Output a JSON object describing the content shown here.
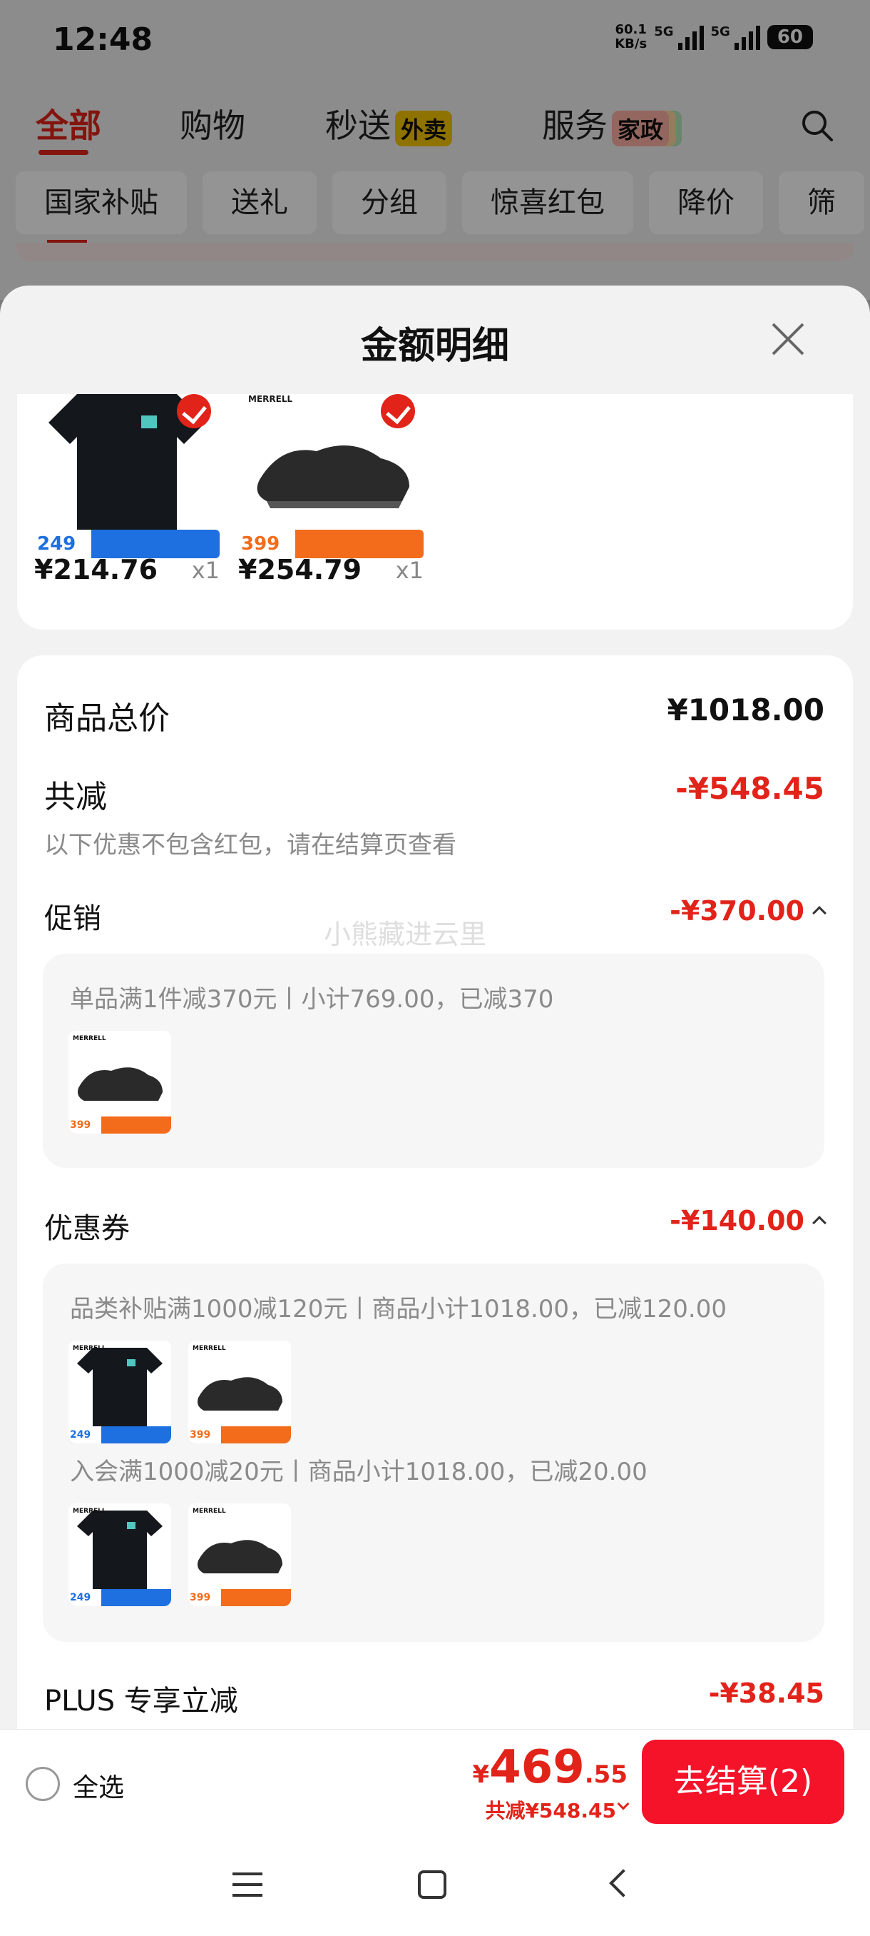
{
  "status_bar": {
    "time": "12:48",
    "net_speed_value": "60.1",
    "net_speed_unit": "KB/s",
    "sim1_label": "5G",
    "sim2_label": "5G",
    "battery": "60"
  },
  "top_nav": {
    "tabs": [
      {
        "label": "全部"
      },
      {
        "label": "购物"
      },
      {
        "label": "秒送",
        "badge": "外卖"
      },
      {
        "label": "服务",
        "badge": "家政"
      }
    ],
    "search_icon": "search-icon"
  },
  "filter_chips": [
    "国家补贴",
    "送礼",
    "分组",
    "惊喜红包",
    "降价",
    "筛"
  ],
  "sheet": {
    "title": "金额明细",
    "close_icon": "close-icon",
    "products": [
      {
        "price": "¥214.76",
        "qty": "x1",
        "tag_price": "249",
        "tag_color": "#1e6fe0"
      },
      {
        "price": "¥254.79",
        "qty": "x1",
        "tag_price": "399",
        "tag_color": "#f26c1c",
        "brand": "MERRELL"
      }
    ],
    "summary": {
      "total_label": "商品总价",
      "total_value": "¥1018.00",
      "discount_label": "共减",
      "discount_value": "-¥548.45",
      "discount_note": "以下优惠不包含红包，请在结算页查看",
      "promo_label": "促销",
      "promo_value": "-¥370.00",
      "promo_detail": "单品满1件减370元丨小计769.00，已减370",
      "coupon_label": "优惠券",
      "coupon_value": "-¥140.00",
      "coupon_detail_1": "品类补贴满1000减120元丨商品小计1018.00，已减120.00",
      "coupon_detail_2": "入会满1000减20元丨商品小计1018.00，已减20.00",
      "plus_label": "PLUS 专享立减",
      "plus_value": "-¥38.45"
    },
    "watermark": "小熊藏进云里"
  },
  "bottom_bar": {
    "select_all": "全选",
    "yen": "¥",
    "price_int": "469",
    "price_dec": ".55",
    "total_save": "共减¥548.45",
    "checkout": "去结算(2)"
  },
  "colors": {
    "accent_red": "#e2231a",
    "checkout_red": "#f5132a",
    "tshirt_tag_blue": "#1e6fe0",
    "shoe_tag_orange": "#f26c1c"
  }
}
